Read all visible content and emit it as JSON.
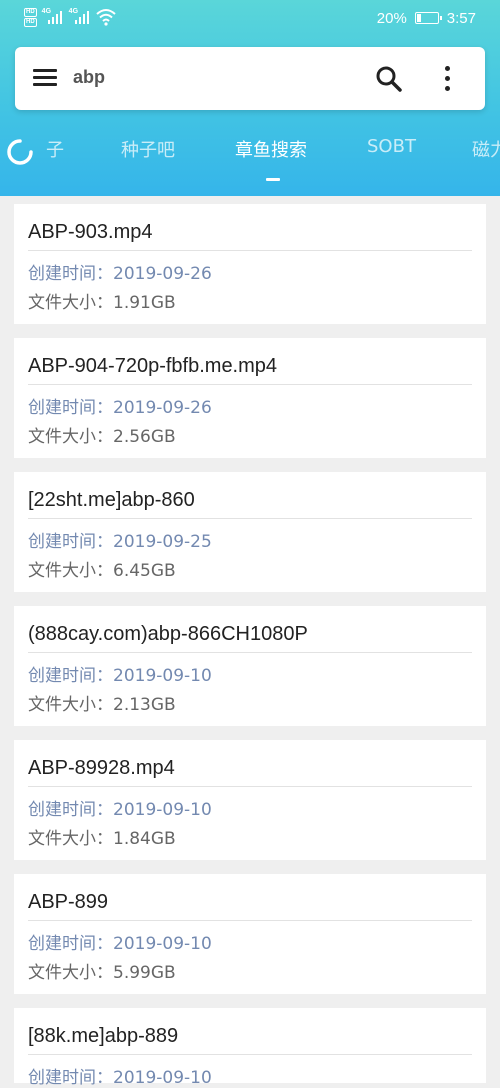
{
  "status_bar": {
    "hd1": "HD",
    "hd2": "HD",
    "net1": "4G",
    "net2": "4G",
    "battery_percent": "20%",
    "battery_level": 0.2,
    "time": "3:57"
  },
  "search": {
    "query": "abp",
    "menu_icon": "hamburger-menu-icon",
    "search_icon": "search-icon",
    "more_icon": "more-vertical-icon"
  },
  "tabs": [
    {
      "label": "子",
      "active": false
    },
    {
      "label": "种子吧",
      "active": false
    },
    {
      "label": "章鱼搜索",
      "active": true
    },
    {
      "label": "SOBT",
      "active": false
    },
    {
      "label": "磁力",
      "active": false
    }
  ],
  "labels": {
    "created": "创建时间：",
    "size": "文件大小："
  },
  "results": [
    {
      "title": "ABP-903.mp4",
      "created": "2019-09-26",
      "size": "1.91GB"
    },
    {
      "title": "ABP-904-720p-fbfb.me.mp4",
      "created": "2019-09-26",
      "size": "2.56GB"
    },
    {
      "title": "[22sht.me]abp-860",
      "created": "2019-09-25",
      "size": "6.45GB"
    },
    {
      "title": "(888cay.com)abp-866CH1080P",
      "created": "2019-09-10",
      "size": "2.13GB"
    },
    {
      "title": "ABP-89928.mp4",
      "created": "2019-09-10",
      "size": "1.84GB"
    },
    {
      "title": "ABP-899",
      "created": "2019-09-10",
      "size": "5.99GB"
    },
    {
      "title": "[88k.me]abp-889",
      "created": "2019-09-10",
      "size": ""
    }
  ],
  "colors": {
    "header_top": "#5ad6d9",
    "header_bottom": "#35b5ea",
    "date_text": "#7389b0",
    "background": "#efefef"
  }
}
